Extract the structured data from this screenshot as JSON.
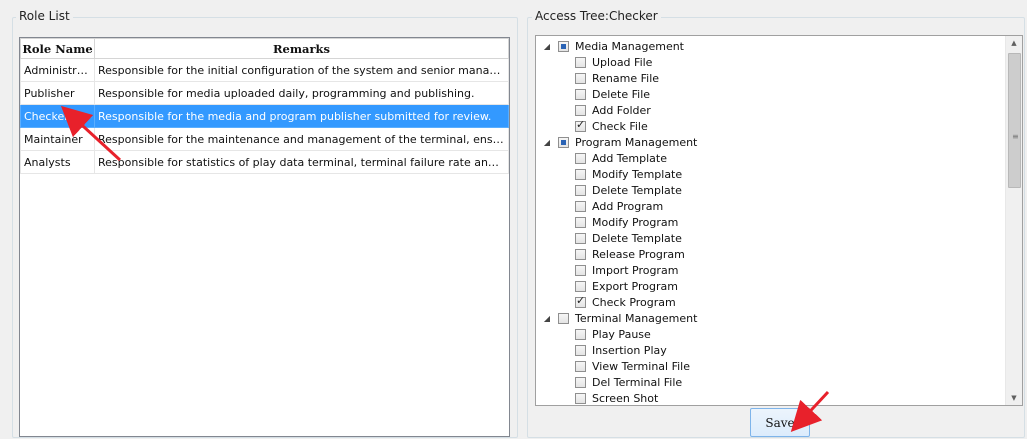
{
  "role_list": {
    "title": "Role List",
    "columns": [
      "Role Name",
      "Remarks"
    ],
    "rows": [
      {
        "name": "Administrator",
        "remarks": "Responsible for the initial configuration of the system and senior management, ..."
      },
      {
        "name": "Publisher",
        "remarks": "Responsible for media uploaded daily, programming and publishing."
      },
      {
        "name": "Checker",
        "remarks": "Responsible for the media and program publisher submitted for review.",
        "selected": true
      },
      {
        "name": "Maintainer",
        "remarks": "Responsible for the maintenance and management of the terminal, ensure the t..."
      },
      {
        "name": "Analysts",
        "remarks": "Responsible for statistics of play data terminal, terminal failure rate and other pa..."
      }
    ]
  },
  "access_tree": {
    "title": "Access Tree:Checker",
    "groups": [
      {
        "label": "Media Management",
        "state": "partial",
        "items": [
          {
            "label": "Upload File",
            "checked": false
          },
          {
            "label": "Rename File",
            "checked": false
          },
          {
            "label": "Delete File",
            "checked": false
          },
          {
            "label": "Add Folder",
            "checked": false
          },
          {
            "label": "Check File",
            "checked": true
          }
        ]
      },
      {
        "label": "Program Management",
        "state": "partial",
        "items": [
          {
            "label": "Add Template",
            "checked": false
          },
          {
            "label": "Modify Template",
            "checked": false
          },
          {
            "label": "Delete Template",
            "checked": false
          },
          {
            "label": "Add Program",
            "checked": false
          },
          {
            "label": "Modify Program",
            "checked": false
          },
          {
            "label": "Delete Template",
            "checked": false
          },
          {
            "label": "Release Program",
            "checked": false
          },
          {
            "label": "Import Program",
            "checked": false
          },
          {
            "label": "Export Program",
            "checked": false
          },
          {
            "label": "Check Program",
            "checked": true
          }
        ]
      },
      {
        "label": "Terminal Management",
        "state": "unchecked",
        "items": [
          {
            "label": "Play Pause",
            "checked": false
          },
          {
            "label": "Insertion Play",
            "checked": false
          },
          {
            "label": "View Terminal File",
            "checked": false
          },
          {
            "label": "Del Terminal File",
            "checked": false
          },
          {
            "label": "Screen Shot",
            "checked": false
          }
        ]
      }
    ]
  },
  "save_label": "Save",
  "icons": {
    "expander": "triangle-expanded-icon",
    "annotation": "red-arrow-icon"
  },
  "colors": {
    "selection": "#3399ff",
    "annotation": "#e8212b"
  }
}
